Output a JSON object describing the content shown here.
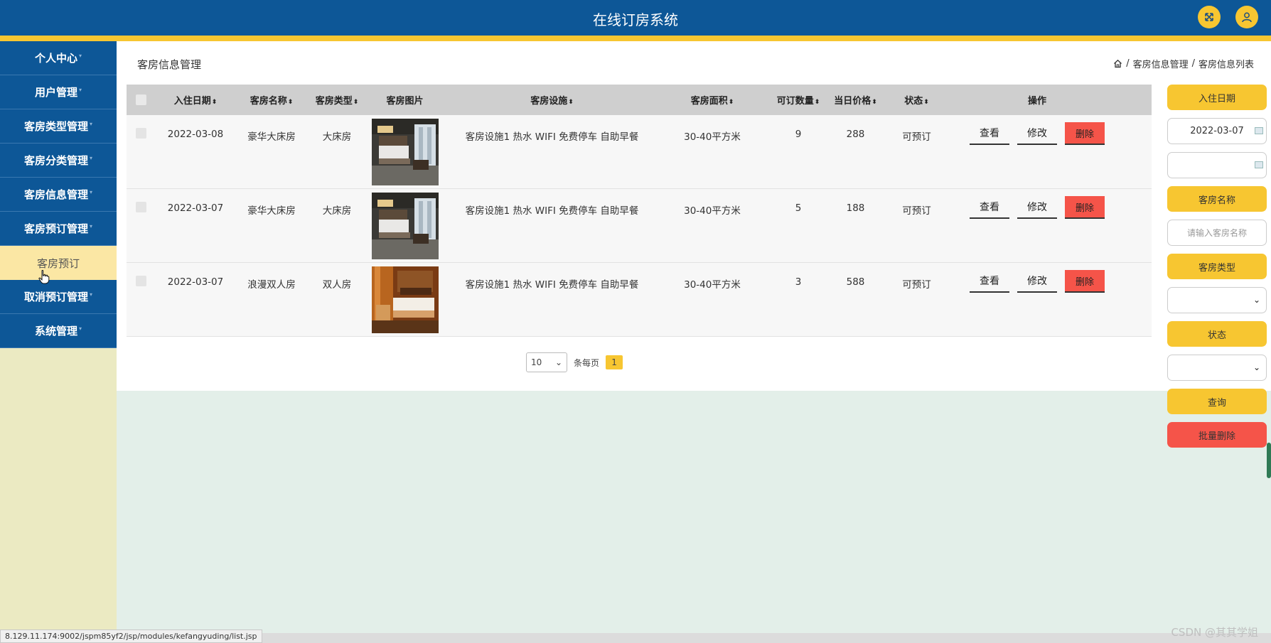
{
  "header": {
    "title": "在线订房系统",
    "fullscreen_icon": "expand-icon",
    "user_icon": "user-icon",
    "accent": "#f7c631",
    "brand": "#0d5797"
  },
  "sidebar": {
    "items": [
      {
        "label": "个人中心"
      },
      {
        "label": "用户管理"
      },
      {
        "label": "客房类型管理"
      },
      {
        "label": "客房分类管理"
      },
      {
        "label": "客房信息管理"
      },
      {
        "label": "客房预订管理"
      },
      {
        "label": "客房预订"
      },
      {
        "label": "取消预订管理"
      },
      {
        "label": "系统管理"
      }
    ]
  },
  "page": {
    "title": "客房信息管理",
    "breadcrumb": [
      "客房信息管理",
      "客房信息列表"
    ],
    "breadcrumb_sep": "/"
  },
  "table": {
    "headers": [
      "入住日期",
      "客房名称",
      "客房类型",
      "客房图片",
      "客房设施",
      "客房面积",
      "可订数量",
      "当日价格",
      "状态",
      "操作"
    ],
    "rows": [
      {
        "date": "2022-03-08",
        "name": "豪华大床房",
        "type": "大床房",
        "facilities": "客房设施1 热水 WIFI 免费停车 自助早餐",
        "area": "30-40平方米",
        "qty": "9",
        "price": "288",
        "status": "可预订"
      },
      {
        "date": "2022-03-07",
        "name": "豪华大床房",
        "type": "大床房",
        "facilities": "客房设施1 热水 WIFI 免费停车 自助早餐",
        "area": "30-40平方米",
        "qty": "5",
        "price": "188",
        "status": "可预订"
      },
      {
        "date": "2022-03-07",
        "name": "浪漫双人房",
        "type": "双人房",
        "facilities": "客房设施1 热水 WIFI 免费停车 自助早餐",
        "area": "30-40平方米",
        "qty": "3",
        "price": "588",
        "status": "可预订"
      }
    ],
    "actions": {
      "view": "查看",
      "edit": "修改",
      "delete": "删除"
    }
  },
  "pager": {
    "page_size": "10",
    "per_page_label": "条每页",
    "current_page": "1"
  },
  "search": {
    "date_label": "入住日期",
    "date_from": "2022-03-07",
    "date_to": "",
    "name_label": "客房名称",
    "name_placeholder": "请输入客房名称",
    "type_label": "客房类型",
    "type_value": "",
    "status_label": "状态",
    "status_value": "",
    "query_button": "查询",
    "batch_delete_button": "批量删除"
  },
  "statusbar": {
    "url": "8.129.11.174:9002/jspm85yf2/jsp/modules/kefangyuding/list.jsp"
  },
  "watermark": "CSDN @其其学姐"
}
